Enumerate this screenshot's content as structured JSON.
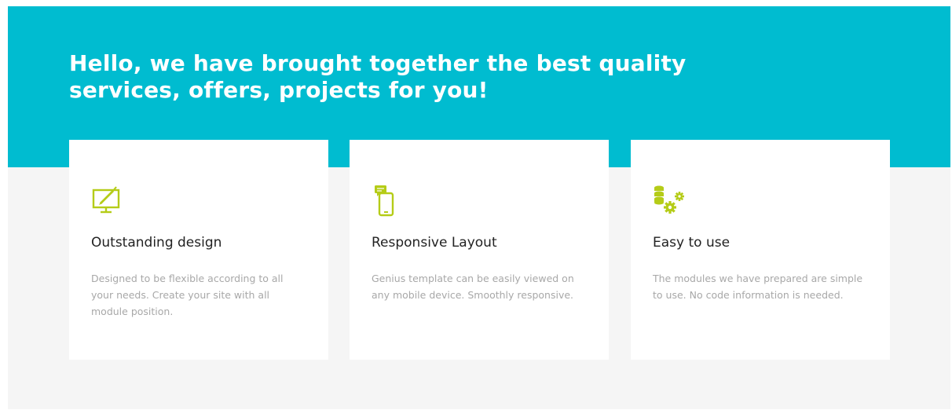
{
  "hero": {
    "title": "Hello, we have brought together the best quality services, offers, projects for you!"
  },
  "colors": {
    "accent": "#00bcd0",
    "icon": "#b5cc18",
    "background": "#f5f5f5",
    "card": "#ffffff"
  },
  "features": [
    {
      "icon": "monitor-pen-icon",
      "title": "Outstanding design",
      "text": "Designed to be flexible according to all your needs. Create your site with all module position."
    },
    {
      "icon": "mobile-chat-icon",
      "title": "Responsive Layout",
      "text": "Genius template can be easily viewed on any mobile device. Smoothly responsive."
    },
    {
      "icon": "database-gears-icon",
      "title": "Easy to use",
      "text": "The modules we have prepared are simple to use. No code information is needed."
    }
  ]
}
